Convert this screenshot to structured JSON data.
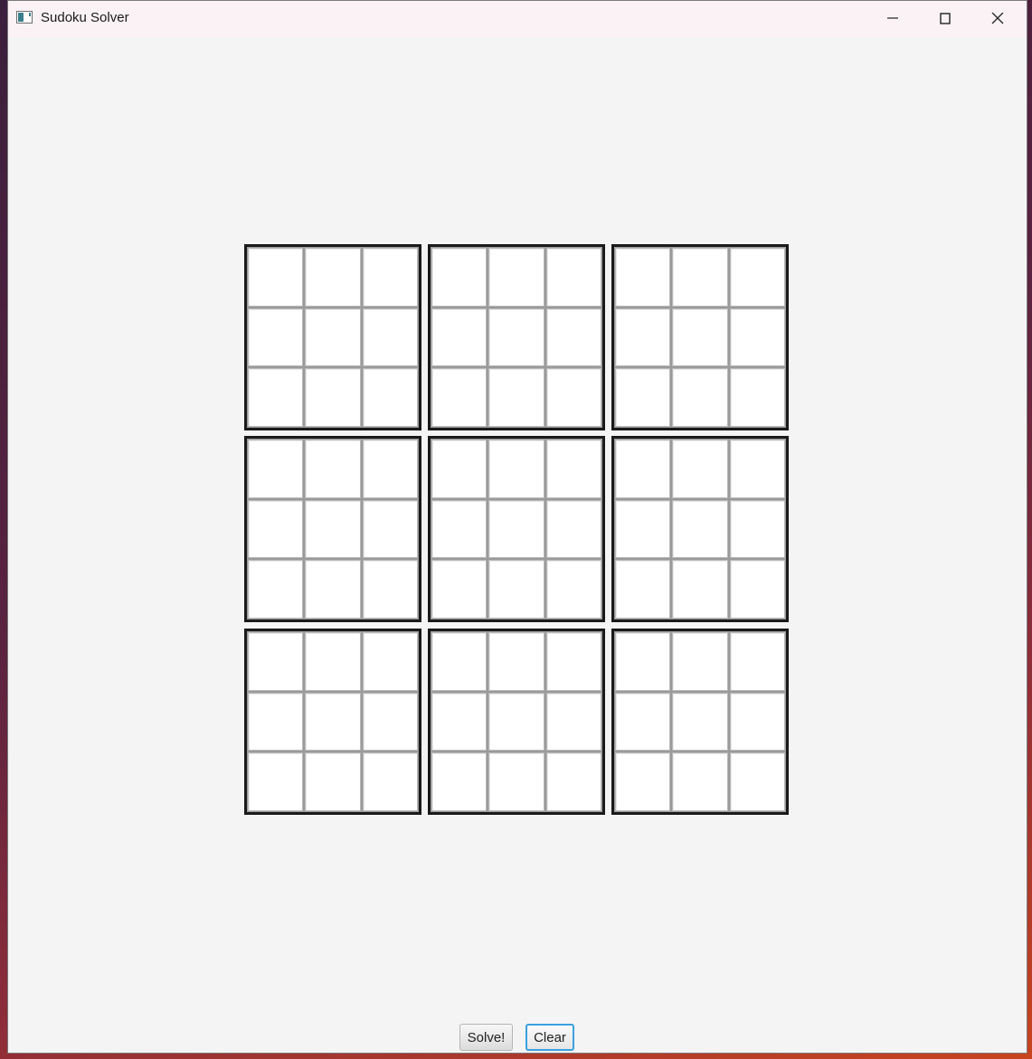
{
  "window": {
    "title": "Sudoku Solver"
  },
  "grid": {
    "boxes": [
      [
        "",
        "",
        "",
        "",
        "",
        "",
        "",
        "",
        ""
      ],
      [
        "",
        "",
        "",
        "",
        "",
        "",
        "",
        "",
        ""
      ],
      [
        "",
        "",
        "",
        "",
        "",
        "",
        "",
        "",
        ""
      ],
      [
        "",
        "",
        "",
        "",
        "",
        "",
        "",
        "",
        ""
      ],
      [
        "",
        "",
        "",
        "",
        "",
        "",
        "",
        "",
        ""
      ],
      [
        "",
        "",
        "",
        "",
        "",
        "",
        "",
        "",
        ""
      ],
      [
        "",
        "",
        "",
        "",
        "",
        "",
        "",
        "",
        ""
      ],
      [
        "",
        "",
        "",
        "",
        "",
        "",
        "",
        "",
        ""
      ],
      [
        "",
        "",
        "",
        "",
        "",
        "",
        "",
        "",
        ""
      ]
    ]
  },
  "buttons": {
    "solve_label": "Solve!",
    "clear_label": "Clear"
  },
  "colors": {
    "focus_accent": "#3aa0e0",
    "box_border": "#1a1a1a"
  }
}
